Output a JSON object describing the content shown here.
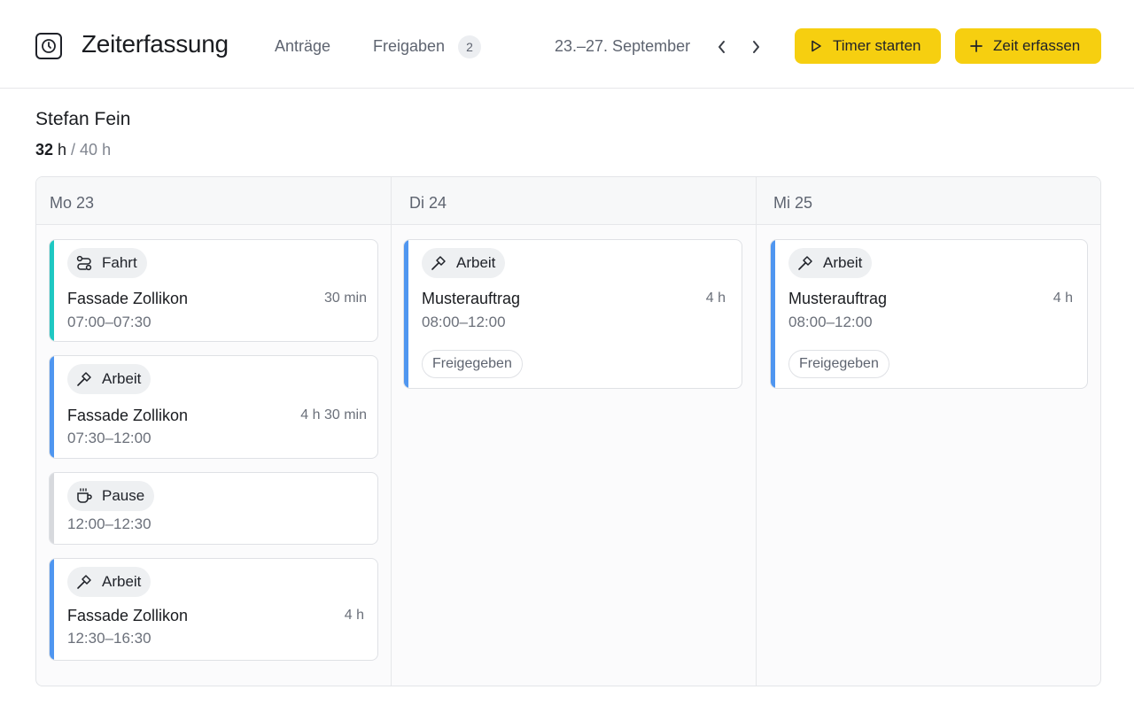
{
  "header": {
    "app_title": "Zeiterfassung",
    "nav": [
      {
        "label": "Anträge"
      },
      {
        "label": "Freigaben",
        "badge": "2"
      }
    ],
    "date_range": "23.–27. September",
    "timer_button": "Timer starten",
    "add_button": "Zeit erfassen",
    "accent_color": "#f6cf10"
  },
  "employee": {
    "name": "Stefan Fein",
    "hours_done": "32",
    "hours_unit": " h",
    "hours_total": " / 40 h"
  },
  "days": [
    {
      "label": "Mo 23"
    },
    {
      "label": "Di 24"
    },
    {
      "label": "Mi 25"
    }
  ],
  "entries": {
    "mo": [
      {
        "type": "Fahrt",
        "icon": "route-icon",
        "title": "Fassade Zollikon",
        "duration": "30 min",
        "time": "07:00–07:30",
        "color": "#1fc8c2"
      },
      {
        "type": "Arbeit",
        "icon": "hammer-icon",
        "title": "Fassade Zollikon",
        "duration": "4 h 30 min",
        "time": "07:30–12:00",
        "color": "#4f96f0"
      },
      {
        "type": "Pause",
        "icon": "coffee-icon",
        "time": "12:00–12:30",
        "color": "#d7d9dd"
      },
      {
        "type": "Arbeit",
        "icon": "hammer-icon",
        "title": "Fassade Zollikon",
        "duration": "4 h",
        "time": "12:30–16:30",
        "color": "#4f96f0"
      }
    ],
    "di": [
      {
        "type": "Arbeit",
        "icon": "hammer-icon",
        "title": "Musterauftrag",
        "duration": "4 h",
        "time": "08:00–12:00",
        "status": "Freigegeben",
        "color": "#4f96f0"
      }
    ],
    "mi": [
      {
        "type": "Arbeit",
        "icon": "hammer-icon",
        "title": "Musterauftrag",
        "duration": "4 h",
        "time": "08:00–12:00",
        "status": "Freigegeben",
        "color": "#4f96f0"
      }
    ]
  }
}
